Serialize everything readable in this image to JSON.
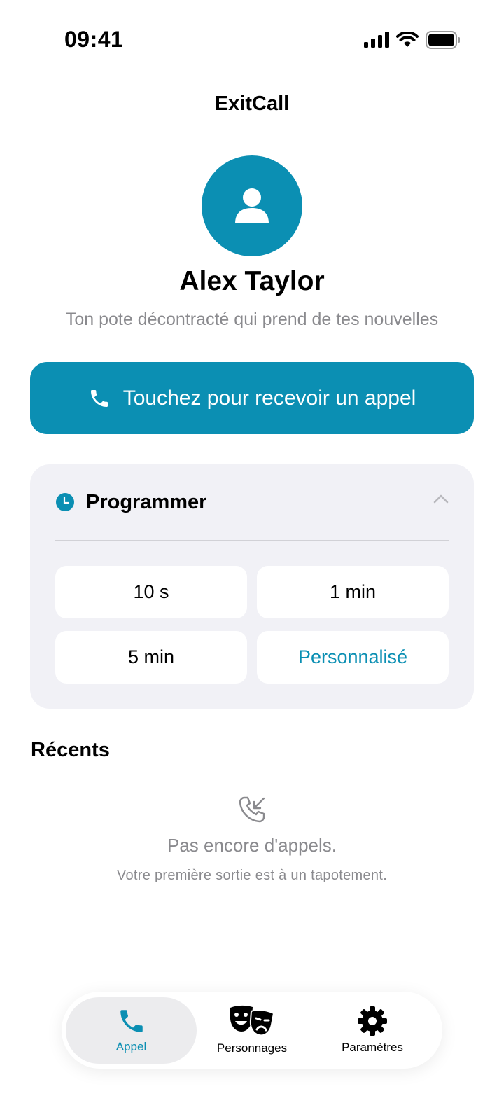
{
  "status_bar": {
    "time": "09:41"
  },
  "header": {
    "title": "ExitCall"
  },
  "contact": {
    "name": "Alex Taylor",
    "description": "Ton pote décontracté qui prend de tes nouvelles",
    "avatar_icon": "person-icon"
  },
  "call_button": {
    "label": "Touchez pour recevoir un appel",
    "icon": "phone-icon"
  },
  "schedule": {
    "title": "Programmer",
    "expanded": true,
    "options": [
      {
        "label": "10 s"
      },
      {
        "label": "1 min"
      },
      {
        "label": "5 min"
      },
      {
        "label": "Personnalisé",
        "accent": true
      }
    ]
  },
  "recents": {
    "title": "Récents",
    "empty_title": "Pas encore d'appels.",
    "empty_subtitle": "Votre première sortie est à un tapotement."
  },
  "tabbar": {
    "tabs": [
      {
        "label": "Appel",
        "icon": "phone-icon",
        "active": true
      },
      {
        "label": "Personnages",
        "icon": "theater-masks-icon",
        "active": false
      },
      {
        "label": "Paramètres",
        "icon": "gear-icon",
        "active": false
      }
    ]
  },
  "colors": {
    "accent": "#0b8fb3",
    "card_bg": "#f1f1f6",
    "secondary_text": "#8a8a8e"
  }
}
